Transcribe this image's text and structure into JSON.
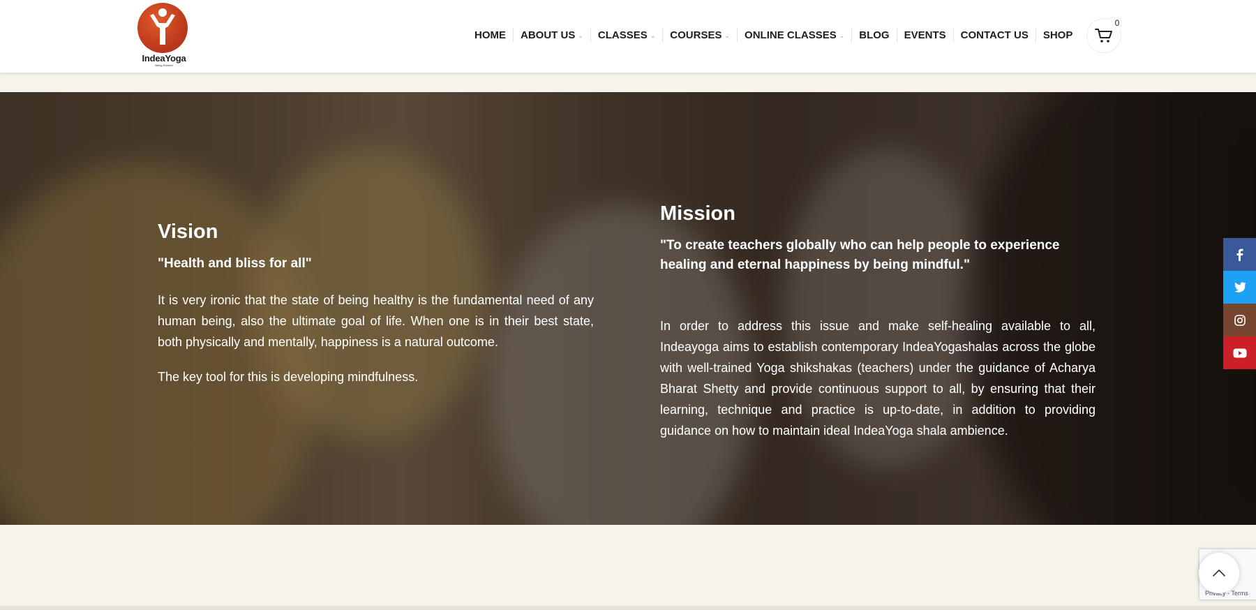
{
  "header": {
    "logo": {
      "name": "IndeaYoga",
      "tagline": "Being Present"
    },
    "nav": [
      {
        "label": "HOME",
        "dropdown": false
      },
      {
        "label": "ABOUT US",
        "dropdown": true
      },
      {
        "label": "CLASSES",
        "dropdown": true
      },
      {
        "label": "COURSES",
        "dropdown": true
      },
      {
        "label": "ONLINE CLASSES",
        "dropdown": true
      },
      {
        "label": "BLOG",
        "dropdown": false
      },
      {
        "label": "EVENTS",
        "dropdown": false
      },
      {
        "label": "CONTACT US",
        "dropdown": false
      },
      {
        "label": "SHOP",
        "dropdown": false
      }
    ],
    "cart": {
      "icon": "cart-icon",
      "count": "0"
    }
  },
  "vision": {
    "title": "Vision",
    "quote": "\"Health and bliss for all\"",
    "paragraphs": [
      "It is very ironic that the state of being healthy is the fundamental need of any human being, also the ultimate goal of life. When one is in their best state, both physically and mentally, happiness is a natural outcome.",
      "The key tool for this is developing mindfulness."
    ]
  },
  "mission": {
    "title": "Mission",
    "quote": "\"To create teachers globally who can help people to experience healing and eternal happiness by being mindful.\"",
    "paragraph": "In order to address this issue and make self-healing available to all, Indeayoga aims to establish contemporary IndeaYogashalas across the globe with well-trained Yoga shikshakas (teachers) under the guidance of Acharya Bharat Shetty and provide continuous support to all, by ensuring that their learning, technique and practice is up-to-date, in addition to providing guidance on how to maintain ideal IndeaYoga shala ambience."
  },
  "social": [
    {
      "icon": "facebook-icon",
      "color": "#3b5998"
    },
    {
      "icon": "twitter-icon",
      "color": "#1da1f2"
    },
    {
      "icon": "instagram-icon",
      "color": "#774430"
    },
    {
      "icon": "youtube-icon",
      "color": "#cb2027"
    }
  ],
  "recaptcha": {
    "text": "Privacy - Terms"
  },
  "colors": {
    "brand": "#c2401f",
    "page_bg": "#f6f2ec"
  }
}
